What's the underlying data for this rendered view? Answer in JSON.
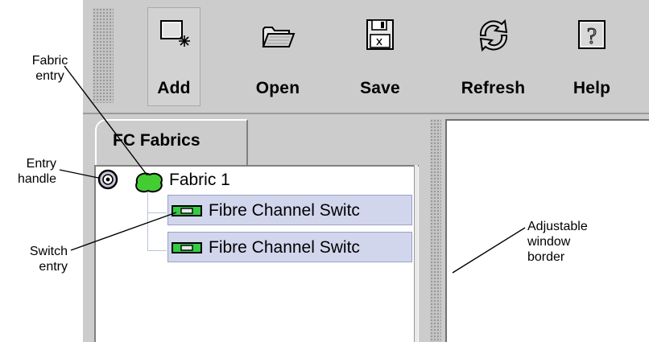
{
  "toolbar": {
    "buttons": [
      {
        "label": "Add",
        "icon": "add-icon"
      },
      {
        "label": "Open",
        "icon": "folder-open-icon"
      },
      {
        "label": "Save",
        "icon": "floppy-disk-icon"
      },
      {
        "label": "Refresh",
        "icon": "refresh-icon"
      },
      {
        "label": "Help",
        "icon": "help-icon"
      }
    ]
  },
  "tab": {
    "label": "FC Fabrics"
  },
  "tree": {
    "fabric": {
      "label": "Fabric 1",
      "icon": "fabric-icon",
      "color": "#44cc33"
    },
    "switches": [
      {
        "label": "Fibre Channel Switc",
        "icon": "switch-icon",
        "color": "#33cc44"
      },
      {
        "label": "Fibre Channel Switc",
        "icon": "switch-icon",
        "color": "#33cc44"
      }
    ]
  },
  "annotations": {
    "fabric_entry": [
      "Fabric",
      "entry"
    ],
    "entry_handle": [
      "Entry",
      "handle"
    ],
    "switch_entry": [
      "Switch",
      "entry"
    ],
    "window_border": [
      "Adjustable",
      "window",
      "border"
    ]
  }
}
